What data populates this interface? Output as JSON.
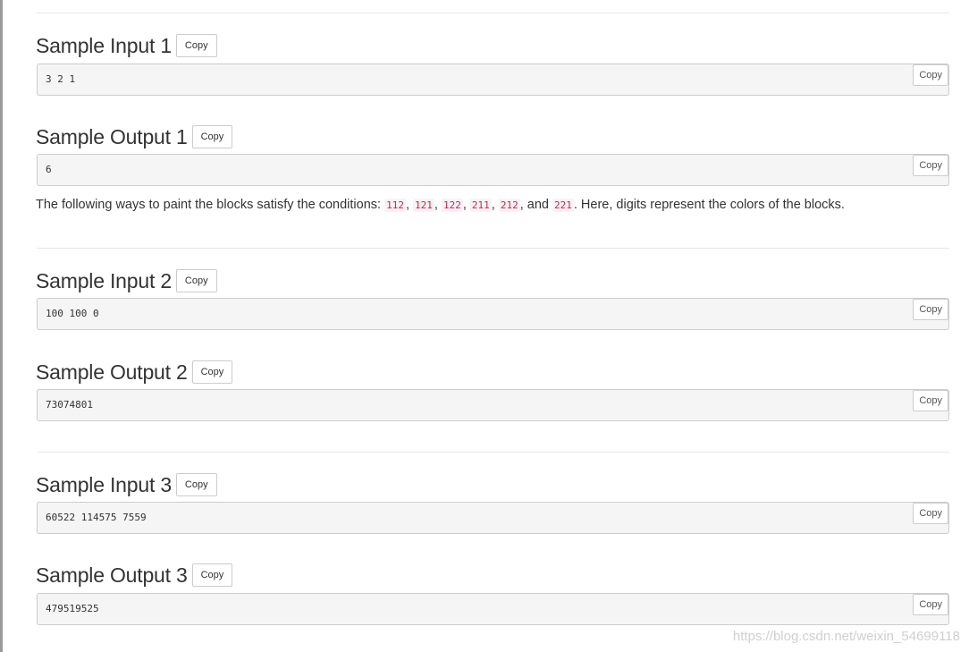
{
  "samples": [
    {
      "input_heading": "Sample Input 1",
      "input_value": "3 2 1",
      "output_heading": "Sample Output 1",
      "output_value": "6"
    },
    {
      "input_heading": "Sample Input 2",
      "input_value": "100 100 0",
      "output_heading": "Sample Output 2",
      "output_value": "73074801"
    },
    {
      "input_heading": "Sample Input 3",
      "input_value": "60522 114575 7559",
      "output_heading": "Sample Output 3",
      "output_value": "479519525"
    }
  ],
  "copy_label": "Copy",
  "explanation": {
    "prefix": "The following ways to paint the blocks satisfy the conditions: ",
    "codes": [
      "112",
      "121",
      "122",
      "211",
      "212",
      "221"
    ],
    "sep": ", ",
    "and": ", and ",
    "suffix": ". Here, digits represent the colors of the blocks."
  },
  "watermark": "https://blog.csdn.net/weixin_54699118"
}
